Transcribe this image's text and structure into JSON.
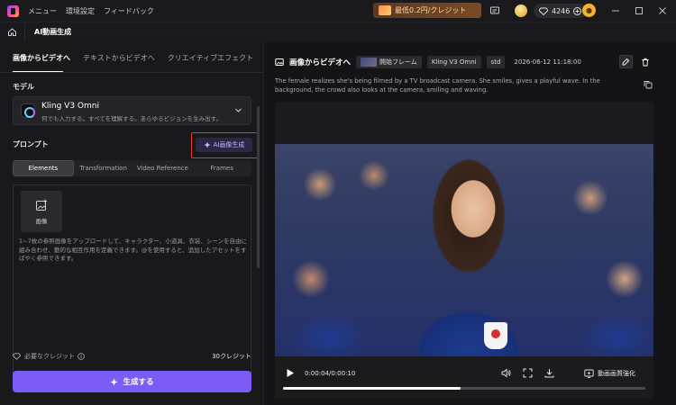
{
  "titlebar": {
    "menu": [
      "メニュー",
      "環境設定",
      "フィードバック"
    ],
    "promo_label": "最低0.2円/クレジット",
    "credits": "4246"
  },
  "tabbar": {
    "active_tab": "AI動画生成"
  },
  "left": {
    "mode_tabs": [
      "画像からビデオへ",
      "テキストからビデオへ",
      "クリエイティブエフェクト"
    ],
    "model_label": "モデル",
    "model_name": "Kling V3 Omni",
    "model_desc": "何でも入力する。すべてを理解する。あらゆるビジョンを生み出す。",
    "prompt_label": "プロンプト",
    "ai_image_label": "AI画像生成",
    "sub_tabs": [
      "Elements",
      "Transformation",
      "Video Reference",
      "Frames"
    ],
    "upload_label": "画像",
    "elements_hint": "1~7枚の参照画像をアップロードして、キャラクター、小道具、衣装、シーンを自由に組み合わせ、動的な相互作用を定義できます。@を使用すると、追加したアセットをすばやく参照できます。",
    "credits_label": "必要なクレジット",
    "credits_value": "30クレジット",
    "generate_label": "生成する"
  },
  "right": {
    "title": "画像からビデオへ",
    "chip_frame": "開始フレーム",
    "chip_model": "Kling V3 Omni",
    "chip_std": "std",
    "date": "2026-06-12 11:18:00",
    "prompt": "The female realizes she's being filmed by a TV broadcast camera. She smiles, gives a playful wave. In the background, the crowd also looks at the camera, smiling and waving.",
    "player": {
      "time": "0:00:04/0:00:10",
      "progress": 0.49,
      "enhance_label": "動画画質強化"
    }
  },
  "colors": {
    "accent": "#7b5cf5",
    "highlight_border": "#e53935",
    "background": "#141416"
  }
}
